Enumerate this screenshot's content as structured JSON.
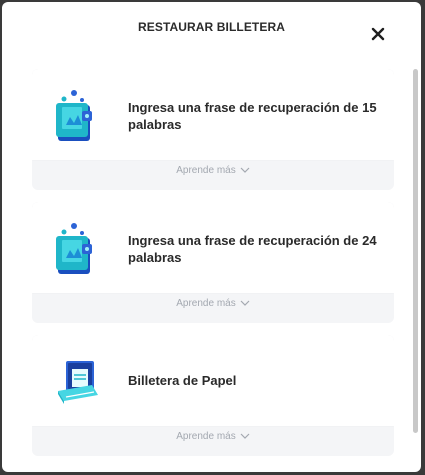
{
  "modal": {
    "title": "RESTAURAR BILLETERA",
    "close_icon": "close-icon"
  },
  "options": [
    {
      "label": "Ingresa una frase de recuperación de 15 palabras",
      "icon": "wallet-icon",
      "learn_more": "Aprende más"
    },
    {
      "label": "Ingresa una frase de recuperación de 24 palabras",
      "icon": "wallet-icon",
      "learn_more": "Aprende más"
    },
    {
      "label": "Billetera de Papel",
      "icon": "paper-wallet-icon",
      "learn_more": "Aprende más"
    }
  ],
  "colors": {
    "accent_teal": "#1fb6c9",
    "accent_blue": "#2c63d6",
    "text_dark": "#2a2a2a",
    "muted": "#a3a8b0"
  }
}
